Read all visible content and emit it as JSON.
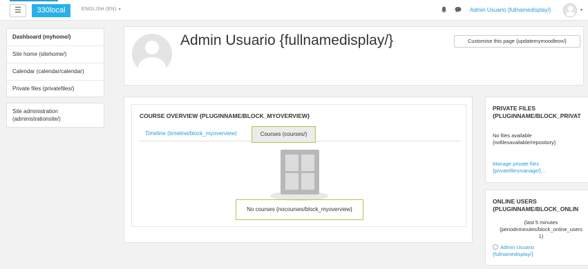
{
  "topbar": {
    "menu_icon": "hamburger-icon",
    "site_name": "330local",
    "language": "ENGLISH (EN)",
    "user_name": "Admin Usuario {fullnamedisplay/}",
    "notification_icon": "bell-icon",
    "message_icon": "chat-icon"
  },
  "nav": {
    "items": [
      {
        "label": "Dashboard (myhome/)"
      },
      {
        "label": "Site home (sitehome/)"
      },
      {
        "label": "Calendar (calendar/calendar)"
      },
      {
        "label": "Private files (privatefiles/)"
      }
    ],
    "admin_label": "Site administration (administrationsite/)"
  },
  "header": {
    "title": "Admin Usuario {fullnamedisplay/}",
    "customise_label": "Customise this page {updatemymoodleon/}"
  },
  "course_overview": {
    "title": "COURSE OVERVIEW {PLUGINNAME/BLOCK_MYOVERVIEW}",
    "tabs": [
      {
        "label": "Timeline (timeline/block_myoverview)"
      },
      {
        "label": "Courses (courses/)"
      }
    ],
    "empty_message": "No courses {nocourses/block_myoverview}"
  },
  "private_files": {
    "title_line1": "PRIVATE FILES",
    "title_line2": "{PLUGINNAME/BLOCK_PRIVAT",
    "empty_line1": "No files available",
    "empty_line2": "{nofilesavailable/repository}",
    "manage_line1": "Manage private files",
    "manage_line2": "{privatefilesmanage/}..."
  },
  "online_users": {
    "title_line1": "ONLINE USERS",
    "title_line2": "{PLUGINNAME/BLOCK_ONLIN",
    "period_line1": "(last 5 minutes",
    "period_line2": "{periodnminutes/block_online_users",
    "period_line3": "1)",
    "user_line1": "Admin Usuario",
    "user_line2": "{fullnamedisplay/}"
  },
  "colors": {
    "brand": "#2ab0e8",
    "link": "#2b9bd6",
    "highlight_border": "#a8c94e"
  }
}
